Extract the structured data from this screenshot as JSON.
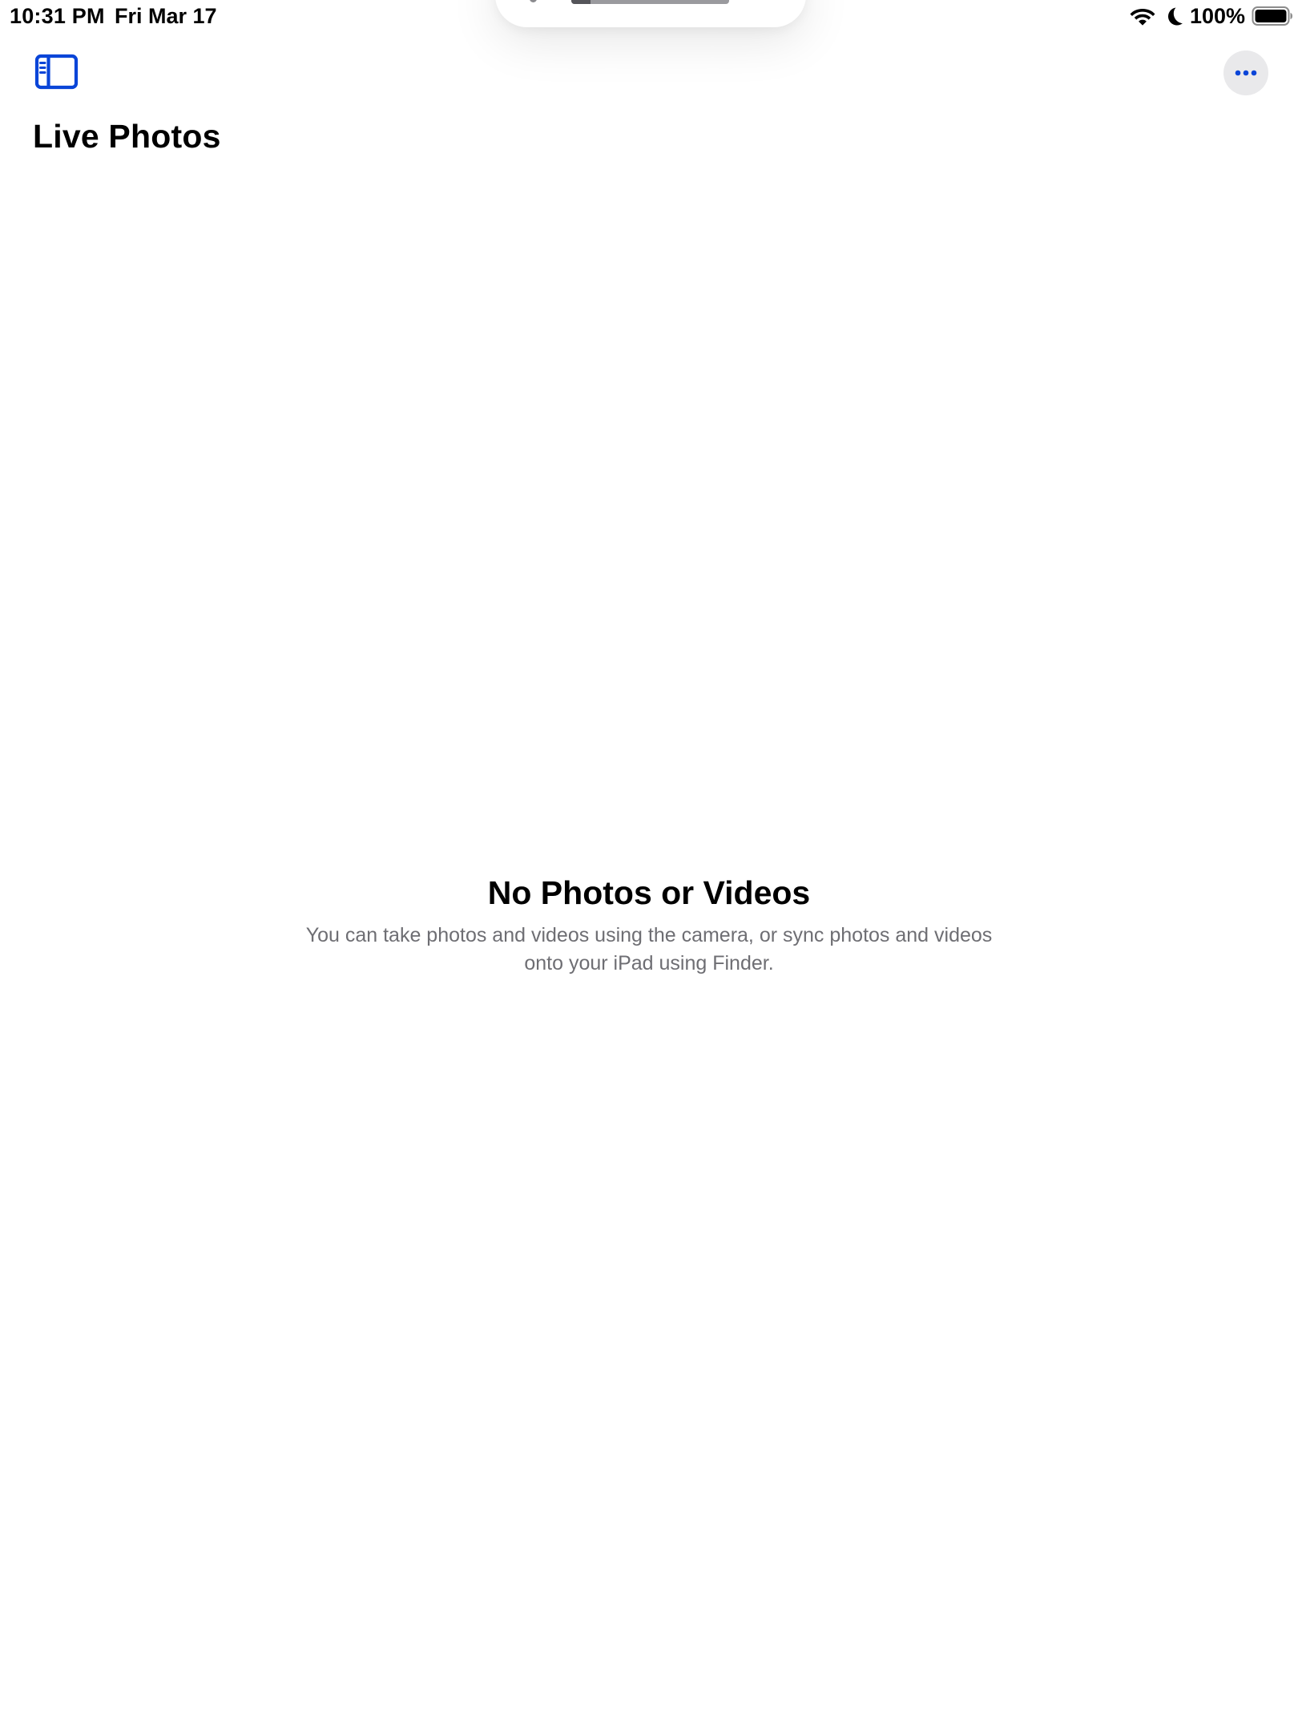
{
  "status_bar": {
    "time": "10:31 PM",
    "date": "Fri Mar 17",
    "battery_percent": "100%",
    "battery_level": 1.0,
    "icons": [
      "wifi-icon",
      "moon-icon",
      "battery-icon"
    ]
  },
  "overlay": {
    "progress_fraction": 0.12
  },
  "toolbar": {
    "left_icon": "sidebar-icon",
    "right_icon": "ellipsis-icon",
    "accent_color": "#0a45d8",
    "more_button_bg": "#e9e9eb"
  },
  "page": {
    "title": "Live Photos"
  },
  "empty_state": {
    "title": "No Photos or Videos",
    "message": "You can take photos and videos using the camera, or sync photos and videos onto your iPad using Finder.",
    "message_color": "#6e6e73"
  }
}
